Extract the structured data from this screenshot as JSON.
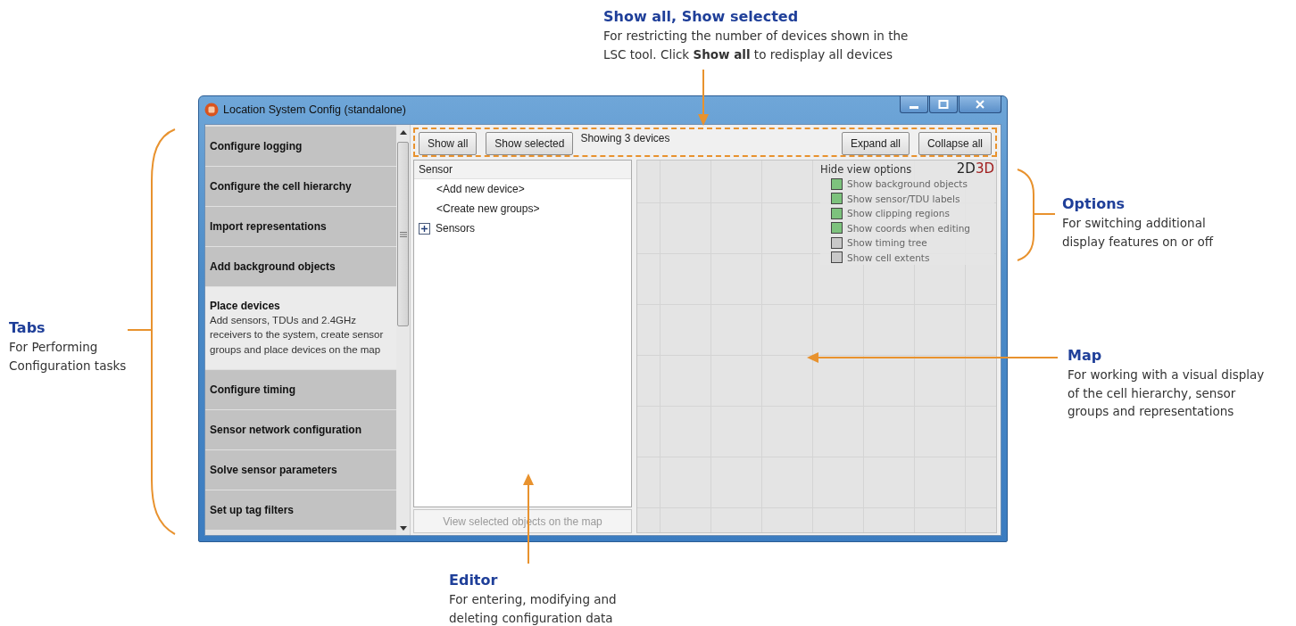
{
  "window": {
    "title": "Location System Config (standalone)"
  },
  "tabs": [
    {
      "label": "Configure logging",
      "selected": false
    },
    {
      "label": "Configure the cell hierarchy",
      "selected": false
    },
    {
      "label": "Import representations",
      "selected": false
    },
    {
      "label": "Add background objects",
      "selected": false
    },
    {
      "label": "Place devices",
      "description": "Add sensors, TDUs and 2.4GHz receivers to the system, create sensor groups and place devices on the map",
      "selected": true
    },
    {
      "label": "Configure timing",
      "selected": false
    },
    {
      "label": "Sensor network configuration",
      "selected": false
    },
    {
      "label": "Solve sensor parameters",
      "selected": false
    },
    {
      "label": "Set up tag filters",
      "selected": false
    }
  ],
  "toolbar": {
    "left_buttons": [
      "Show all",
      "Show selected"
    ],
    "status": "Showing 3 devices",
    "right_buttons": [
      "Expand all",
      "Collapse all"
    ]
  },
  "editor": {
    "header": "Sensor",
    "items": [
      {
        "label": "<Add new device>",
        "kind": "action"
      },
      {
        "label": "<Create new groups>",
        "kind": "action"
      },
      {
        "label": "Sensors",
        "kind": "group",
        "expanded": false
      }
    ],
    "bottom_button": {
      "label": "View selected objects on the map",
      "disabled": true
    }
  },
  "map": {
    "options_title": "Hide view options",
    "view_modes": [
      {
        "label": "2D",
        "selected": false
      },
      {
        "label": "3D",
        "selected": true
      }
    ],
    "options": [
      {
        "label": "Show background objects",
        "checked": true
      },
      {
        "label": "Show sensor/TDU labels",
        "checked": true
      },
      {
        "label": "Show clipping regions",
        "checked": true
      },
      {
        "label": "Show coords when editing",
        "checked": true
      },
      {
        "label": "Show timing tree",
        "checked": false
      },
      {
        "label": "Show cell extents",
        "checked": false
      }
    ]
  },
  "callouts": [
    {
      "kind": "top",
      "title": "Show all, Show selected",
      "lines": [
        "For restricting the number of devices shown in the",
        "LSC tool. Click **Show all** to redisplay all devices"
      ]
    },
    {
      "kind": "tabs",
      "title": "Tabs",
      "lines": [
        "For Performing",
        "Configuration tasks"
      ]
    },
    {
      "kind": "options",
      "title": "Options",
      "lines": [
        "For switching additional",
        "display features on or off"
      ]
    },
    {
      "kind": "map",
      "title": "Map",
      "lines": [
        "For working with a visual display",
        "of the cell hierarchy, sensor",
        "groups and representations"
      ]
    },
    {
      "kind": "editor",
      "title": "Editor",
      "lines": [
        "For entering, modifying and",
        "deleting configuration data"
      ]
    }
  ]
}
